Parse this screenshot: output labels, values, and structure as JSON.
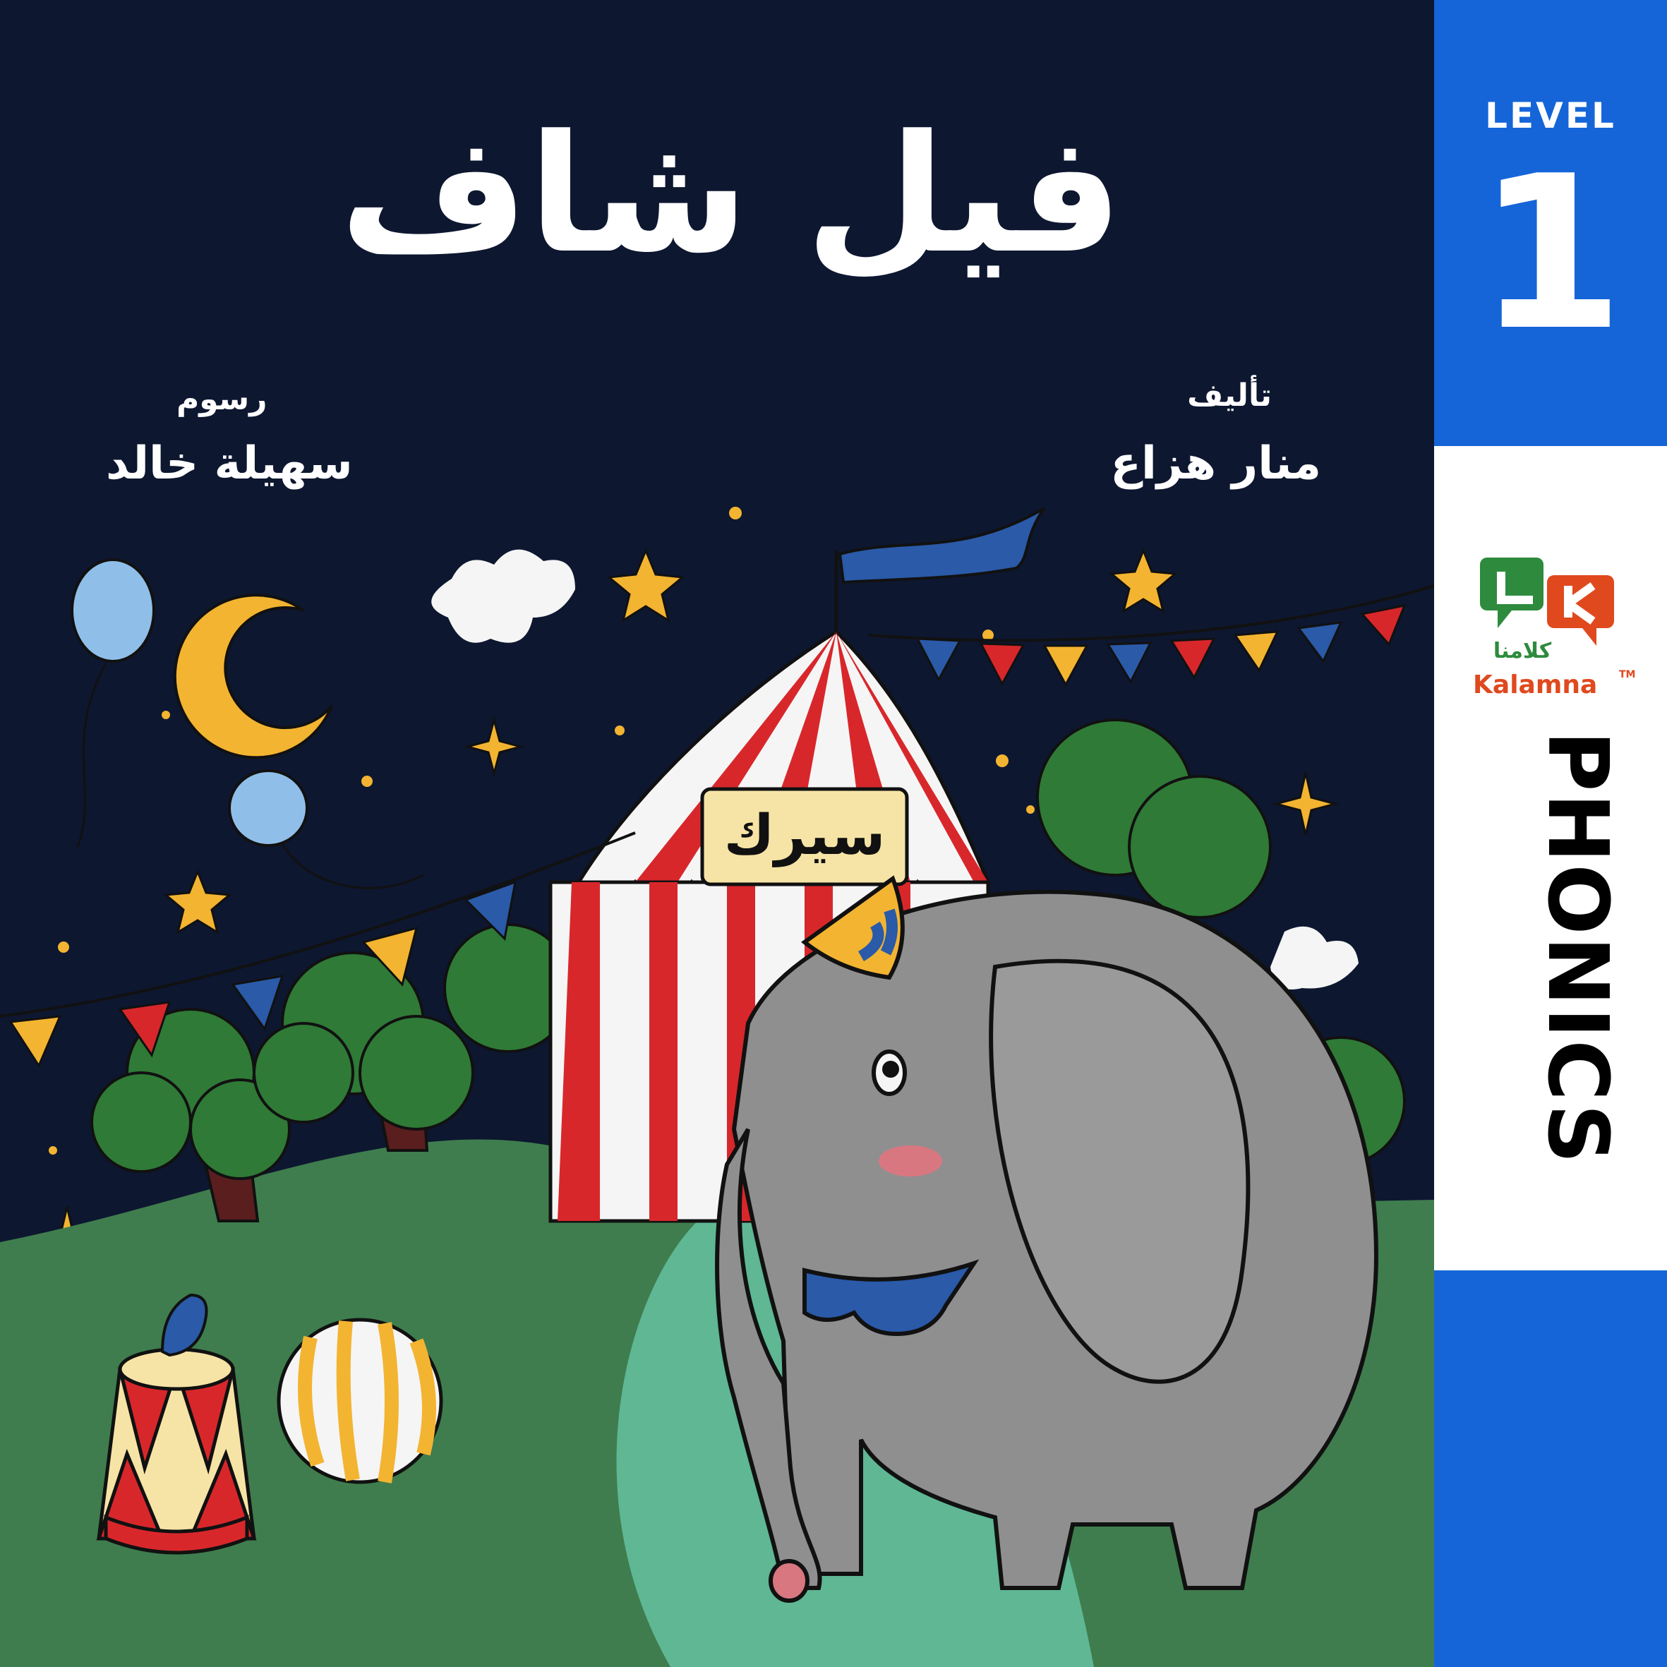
{
  "book": {
    "title": "فيل شاف",
    "author_role": "تأليف",
    "author_name": "منار هزاع",
    "illustrator_role": "رسوم",
    "illustrator_name": "سهيلة خالد",
    "tent_sign": "سيرك"
  },
  "sidebar": {
    "level_label": "LEVEL",
    "level_number": "1",
    "series_label": "PHONICS",
    "brand_ar": "كلامنا",
    "brand_en": "Kalamna",
    "trademark": "TM"
  },
  "colors": {
    "night_sky": "#0d1730",
    "sidebar_blue": "#1565d8",
    "grass": "#3f7d4e",
    "path": "#5fb794",
    "elephant": "#8f8f8f",
    "star": "#f3b431",
    "tent_red": "#d8272b"
  },
  "icons": [
    "star-icon",
    "crescent-moon-icon",
    "balloon-icon",
    "kalamna-logo-icon"
  ]
}
